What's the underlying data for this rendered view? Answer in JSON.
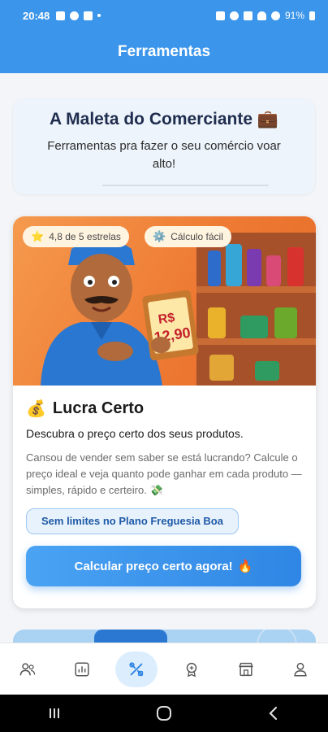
{
  "status_bar": {
    "time": "20:48",
    "battery": "91%"
  },
  "app_bar": {
    "title": "Ferramentas"
  },
  "header": {
    "title": "A Maleta do Comerciante",
    "title_icon": "💼",
    "subtitle": "Ferramentas pra fazer o seu comércio voar alto!"
  },
  "tool": {
    "hero": {
      "price_label_1": "R$",
      "price_label_2": "12,90",
      "chips": [
        {
          "icon": "⭐",
          "label": "4,8 de 5 estrelas"
        },
        {
          "icon": "⚙️",
          "label": "Cálculo fácil"
        }
      ]
    },
    "icon": "💰",
    "title": "Lucra Certo",
    "subtitle": "Descubra o preço certo dos seus produtos.",
    "description": "Cansou de vender sem saber se está lucrando? Calcule o preço ideal e veja quanto pode ganhar em cada produto — simples, rápido e certeiro. 💸",
    "plan_badge": "Sem limites no Plano Freguesia Boa",
    "cta_label": "Calcular preço certo agora!",
    "cta_icon": "🔥"
  },
  "bottom_nav": {
    "items": [
      {
        "icon": "customers-icon",
        "active": false
      },
      {
        "icon": "chart-icon",
        "active": false
      },
      {
        "icon": "tools-icon",
        "active": true
      },
      {
        "icon": "badge-icon",
        "active": false
      },
      {
        "icon": "store-icon",
        "active": false
      },
      {
        "icon": "profile-icon",
        "active": false
      }
    ]
  },
  "colors": {
    "primary": "#3b95ea",
    "cta": "#2f86e4",
    "hero": "#ee7a33"
  }
}
